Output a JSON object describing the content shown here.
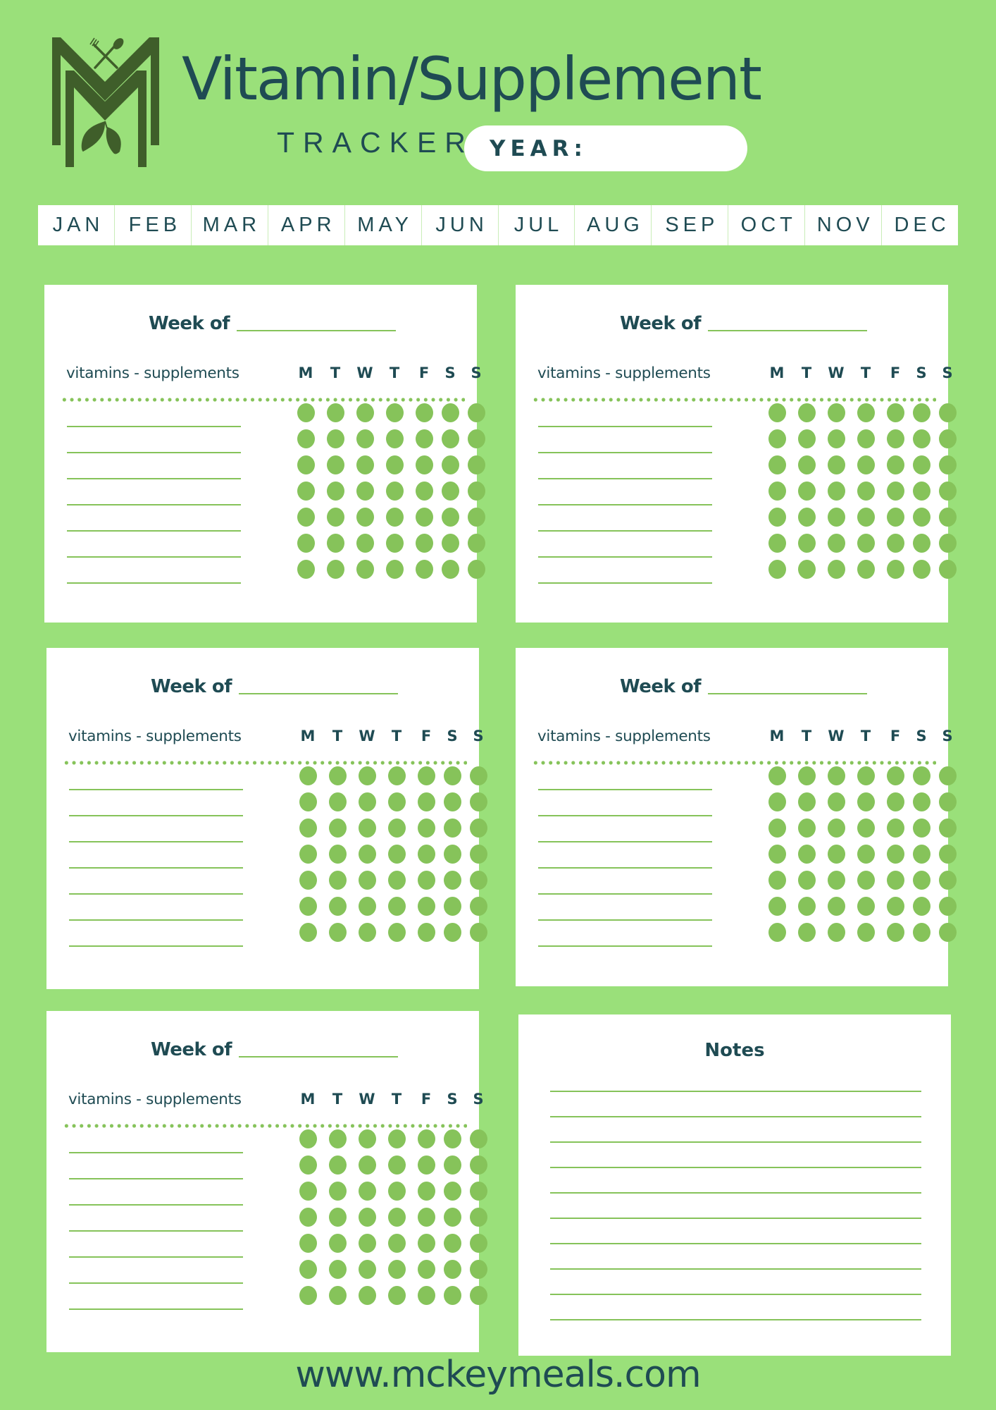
{
  "header": {
    "title": "Vitamin/Supplement",
    "subtitle": "TRACKER",
    "year_label": "YEAR:",
    "year_value": ""
  },
  "months": [
    "JAN",
    "FEB",
    "MAR",
    "APR",
    "MAY",
    "JUN",
    "JUL",
    "AUG",
    "SEP",
    "OCT",
    "NOV",
    "DEC"
  ],
  "week_card": {
    "week_label": "Week of",
    "column_header": "vitamins - supplements",
    "days": [
      "M",
      "T",
      "W",
      "T",
      "F",
      "S",
      "S"
    ],
    "row_count": 7
  },
  "week_cards": [
    {
      "id": "week-1",
      "week_of": ""
    },
    {
      "id": "week-2",
      "week_of": ""
    },
    {
      "id": "week-3",
      "week_of": ""
    },
    {
      "id": "week-4",
      "week_of": ""
    },
    {
      "id": "week-5",
      "week_of": ""
    }
  ],
  "notes": {
    "title": "Notes",
    "line_count": 10
  },
  "footer": {
    "website": "www.mckeymeals.com"
  },
  "colors": {
    "background": "#9AE07A",
    "card": "#FFFFFF",
    "text": "#1F4B53",
    "accent_green": "#86C35A",
    "logo_green": "#3F5E2A"
  }
}
